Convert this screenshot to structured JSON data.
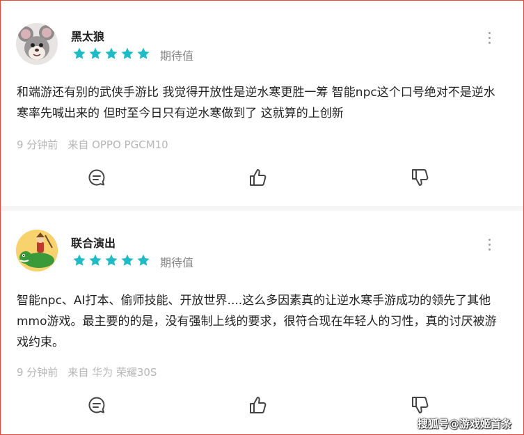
{
  "comments": [
    {
      "username": "黑太狼",
      "stars": 5,
      "rating_label": "期待值",
      "text": "和端游还有别的武侠手游比 我觉得开放性是逆水寒更胜一筹 智能npc这个口号绝对不是逆水寒率先喊出来的 但时至今日只有逆水寒做到了 这就算的上创新",
      "time": "9 分钟前",
      "device": "来自 OPPO PGCM10",
      "avatar_icon": "cartoon-mouse-avatar"
    },
    {
      "username": "联合演出",
      "stars": 5,
      "rating_label": "期待值",
      "text": "智能npc、AI打本、偷师技能、开放世界....这么多因素真的让逆水寒手游成功的领先了其他mmo游戏。最主要的的是，没有强制上线的要求，很符合现在年轻人的习性，真的讨厌被游戏约束。",
      "time": "9 分钟前",
      "device": "来自 华为 荣耀30S",
      "avatar_icon": "cartoon-dinosaur-rider-avatar"
    }
  ],
  "icons": {
    "star": "star-icon",
    "more": "more-vertical-icon",
    "comment": "comment-icon",
    "like": "thumbs-up-icon",
    "dislike": "thumbs-down-icon"
  },
  "colors": {
    "star": "#1fbcc8",
    "frame_border": "#e8463a",
    "text": "#222222",
    "muted": "#b6b6b6",
    "rating_label": "#888888"
  },
  "watermark": "搜狐号@游戏姬首条"
}
